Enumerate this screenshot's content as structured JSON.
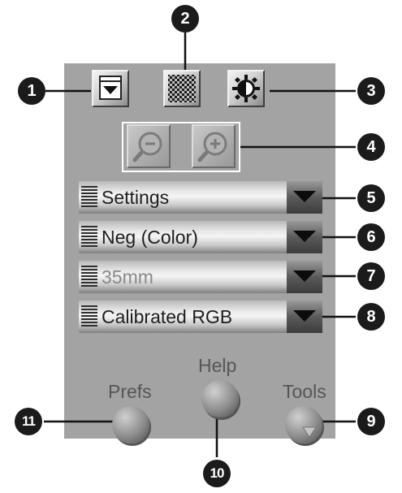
{
  "toolbar": {
    "buttons": [
      {
        "icon": "dock-icon"
      },
      {
        "icon": "checker-icon"
      },
      {
        "icon": "contrast-icon"
      }
    ]
  },
  "zoom": {
    "out_icon": "zoom-out-icon",
    "in_icon": "zoom-in-icon"
  },
  "dropdowns": [
    {
      "value": "Settings",
      "enabled": true
    },
    {
      "value": "Neg (Color)",
      "enabled": true
    },
    {
      "value": "35mm",
      "enabled": false
    },
    {
      "value": "Calibrated RGB",
      "enabled": true
    }
  ],
  "buttons": {
    "prefs_label": "Prefs",
    "help_label": "Help",
    "tools_label": "Tools"
  },
  "callouts": [
    "1",
    "2",
    "3",
    "4",
    "5",
    "6",
    "7",
    "8",
    "9",
    "10",
    "11"
  ],
  "colors": {
    "panel": "#a3a3a3",
    "callout_badge": "#1b1b1b"
  }
}
